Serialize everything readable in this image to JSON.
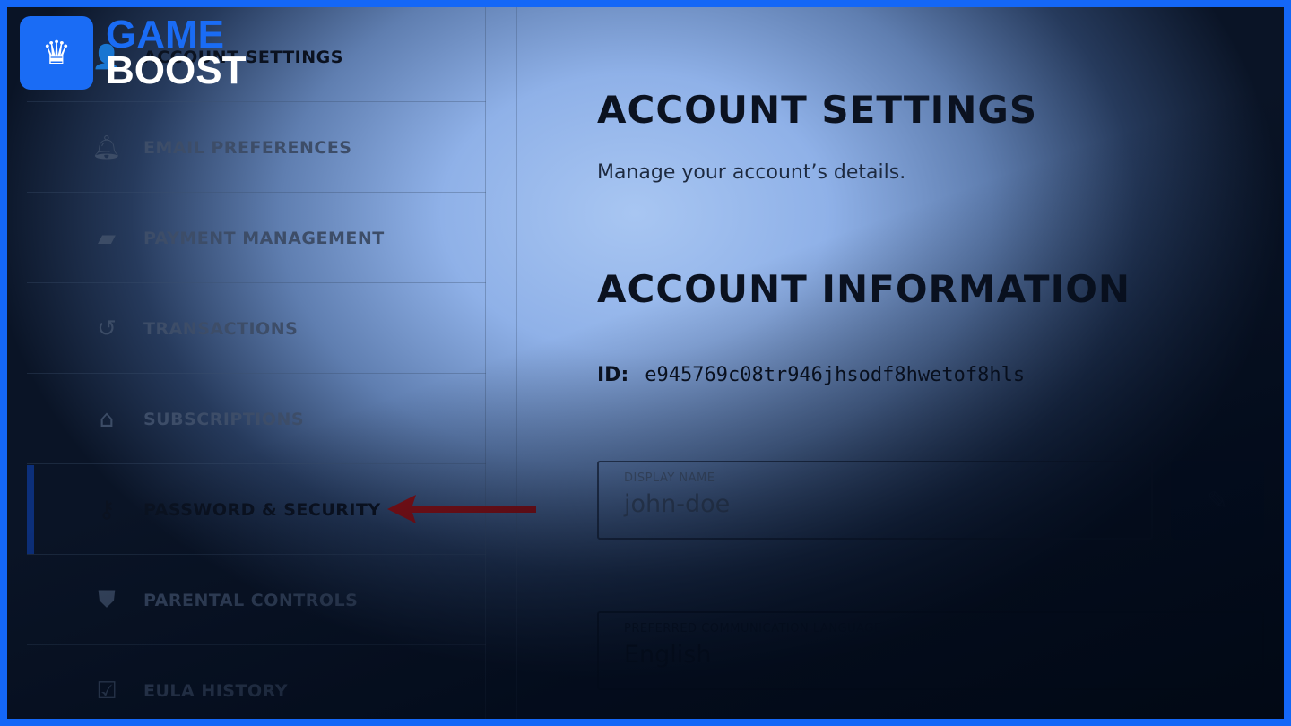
{
  "logo": {
    "line1": "GAME",
    "line2": "BOOST"
  },
  "sidebar": {
    "items": [
      {
        "label": "ACCOUNT SETTINGS",
        "icon": "user-icon"
      },
      {
        "label": "EMAIL PREFERENCES",
        "icon": "bell-icon"
      },
      {
        "label": "PAYMENT MANAGEMENT",
        "icon": "wallet-icon"
      },
      {
        "label": "TRANSACTIONS",
        "icon": "history-icon"
      },
      {
        "label": "SUBSCRIPTIONS",
        "icon": "subscription-icon"
      },
      {
        "label": "PASSWORD & SECURITY",
        "icon": "key-icon"
      },
      {
        "label": "PARENTAL CONTROLS",
        "icon": "shield-icon"
      },
      {
        "label": "EULA HISTORY",
        "icon": "checklist-icon"
      }
    ]
  },
  "main": {
    "title": "ACCOUNT SETTINGS",
    "subtitle": "Manage your account’s details.",
    "section_title": "ACCOUNT INFORMATION",
    "id_label": "ID:",
    "id_value": "e945769c08tr946jhsodf8hwetof8hls",
    "display_name_label": "DISPLAY NAME",
    "display_name_value": "john-doe",
    "language_label": "PREFERRED COMMUNICATION LANGUAGE",
    "language_value": "English"
  },
  "colors": {
    "border": "#1467f7",
    "arrow": "#8b0f14",
    "active": "#0c2f7a"
  }
}
